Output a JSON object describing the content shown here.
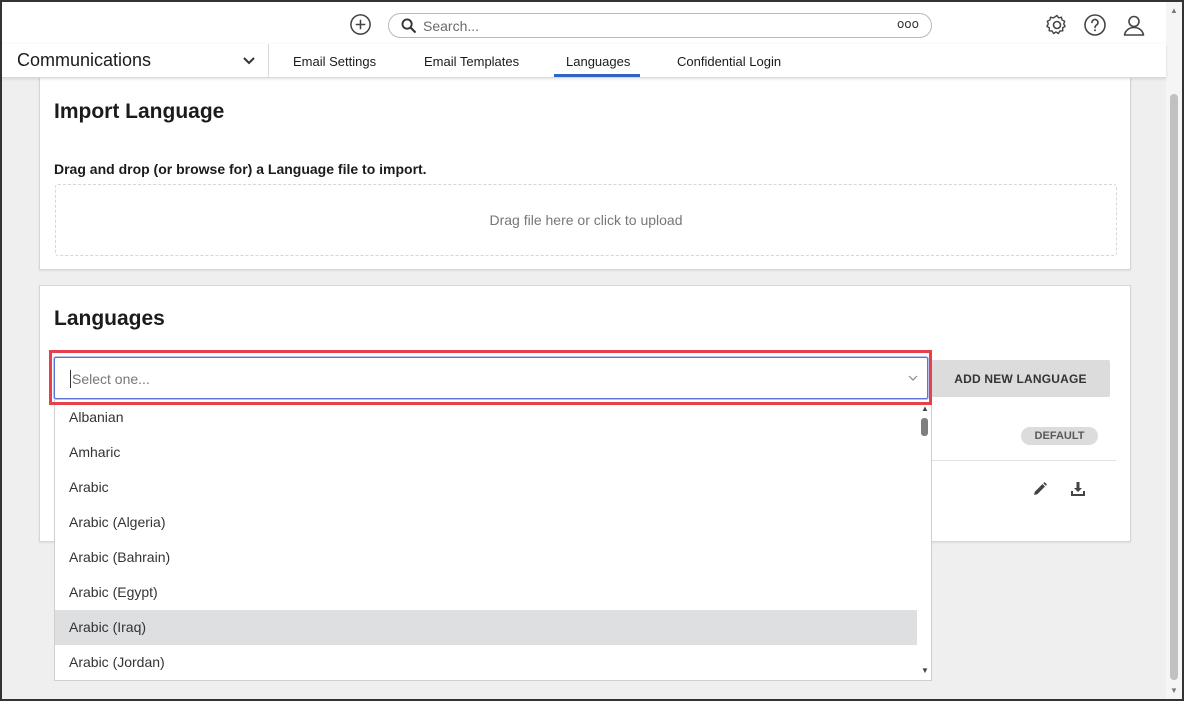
{
  "topbar": {
    "add_icon": "plus-circle-icon",
    "search": {
      "placeholder": "Search...",
      "more_label": "ooo",
      "icon": "search-icon"
    },
    "icons": [
      "gear-icon",
      "help-icon",
      "user-icon"
    ]
  },
  "nav": {
    "module": "Communications",
    "tabs": [
      {
        "label": "Email Settings"
      },
      {
        "label": "Email Templates"
      },
      {
        "label": "Languages",
        "active": true
      },
      {
        "label": "Confidential Login"
      }
    ],
    "accent": "#2f63c9"
  },
  "import_card": {
    "title": "Import Language",
    "description": "Drag and drop (or browse for) a Language file to import.",
    "dropzone_text": "Drag file here or click to upload"
  },
  "languages_card": {
    "title": "Languages",
    "select": {
      "placeholder": "Select one..."
    },
    "add_button": "ADD NEW LANGUAGE",
    "default_badge": "DEFAULT",
    "row_icons": [
      "pencil-icon",
      "download-icon"
    ]
  },
  "dropdown": {
    "options": [
      {
        "label": "Albanian"
      },
      {
        "label": "Amharic"
      },
      {
        "label": "Arabic"
      },
      {
        "label": "Arabic (Algeria)"
      },
      {
        "label": "Arabic (Bahrain)"
      },
      {
        "label": "Arabic (Egypt)"
      },
      {
        "label": "Arabic (Iraq)",
        "hovered": true
      },
      {
        "label": "Arabic (Jordan)"
      }
    ]
  },
  "highlight_color": "#e5404b"
}
